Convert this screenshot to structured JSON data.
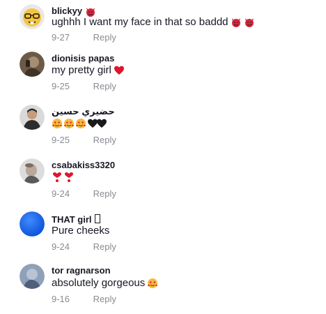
{
  "comments": [
    {
      "username": "blickyy",
      "username_emoji": "smiling-devil-emoji",
      "text": "ughhh I want my face in that so baddd",
      "emojis": [
        "smiling-devil-emoji",
        "smiling-devil-emoji"
      ],
      "date": "9-27",
      "reply": "Reply"
    },
    {
      "username": "dionisis papas",
      "text": "my pretty girl",
      "emojis": [
        "red-heart-emoji"
      ],
      "date": "9-25",
      "reply": "Reply"
    },
    {
      "username": "حضيري حسين",
      "text": "",
      "emojis": [
        "smiling-hearts-emoji",
        "smiling-hearts-emoji",
        "smiling-hearts-emoji",
        "black-heart-emoji",
        "black-heart-emoji"
      ],
      "date": "9-25",
      "reply": "Reply"
    },
    {
      "username": "csabakiss3320",
      "text": "",
      "emojis": [
        "heart-exclamation-emoji",
        "heart-exclamation-emoji"
      ],
      "date": "9-24",
      "reply": "Reply"
    },
    {
      "username": "THAT girl",
      "username_emoji": "missing-glyph-box",
      "text": "Pure cheeks",
      "emojis": [],
      "date": "9-24",
      "reply": "Reply"
    },
    {
      "username": "tor ragnarson",
      "text": "absolutely gorgeous",
      "emojis": [
        "smiling-hearts-emoji"
      ],
      "date": "9-16",
      "reply": "Reply"
    }
  ],
  "colors": {
    "text": "#161823",
    "muted": "#8a8b91",
    "devil": "#d7263d",
    "heart": "#e0152d",
    "avatar_blue": "#1366e6"
  }
}
